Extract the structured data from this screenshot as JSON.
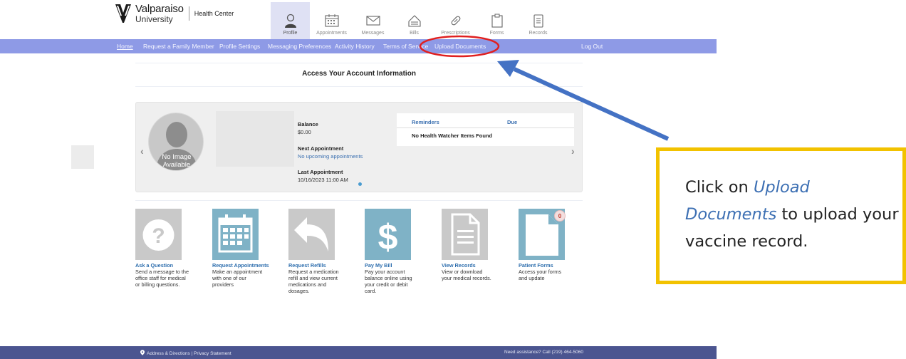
{
  "header": {
    "logo_name": "Valparaiso",
    "logo_sub": "University",
    "logo_product": "Health Center"
  },
  "top_nav": [
    {
      "label": "Profile",
      "icon": "profile-icon",
      "active": true
    },
    {
      "label": "Appointments",
      "icon": "calendar-icon",
      "active": false
    },
    {
      "label": "Messages",
      "icon": "envelope-icon",
      "active": false
    },
    {
      "label": "Bills",
      "icon": "bills-icon",
      "active": false
    },
    {
      "label": "Prescriptions",
      "icon": "pill-icon",
      "active": false
    },
    {
      "label": "Forms",
      "icon": "clipboard-icon",
      "active": false
    },
    {
      "label": "Records",
      "icon": "records-icon",
      "active": false
    }
  ],
  "nav_bar": {
    "items": [
      "Home",
      "Request a Family Member",
      "Profile Settings",
      "Messaging Preferences",
      "Activity History",
      "Terms of Service",
      "Upload Documents"
    ],
    "logout": "Log Out"
  },
  "page_title": "Access Your Account Information",
  "summary": {
    "avatar_text_1": "No Image",
    "avatar_text_2": "Available",
    "balance_label": "Balance",
    "balance_value": "$0.00",
    "next_label": "Next Appointment",
    "next_value": "No upcoming appointments",
    "last_label": "Last Appointment",
    "last_value": "10/16/2023 11:00 AM",
    "reminders_header": "Reminders",
    "due_header": "Due",
    "reminders_empty": "No Health Watcher Items Found"
  },
  "tiles": [
    {
      "title": "Ask a Question",
      "desc": "Send a message to the office staff for medical or billing questions.",
      "icon": "question-icon",
      "color": "#c9c9c9"
    },
    {
      "title": "Request Appointments",
      "desc": "Make an appointment with one of our providers",
      "icon": "calendar-icon",
      "color": "#7fb2c6"
    },
    {
      "title": "Request Refills",
      "desc": "Request a medication refill and view current medications and dosages.",
      "icon": "reply-arrow-icon",
      "color": "#c9c9c9"
    },
    {
      "title": "Pay My Bill",
      "desc": "Pay your account balance online using your credit or debit card.",
      "icon": "dollar-icon",
      "color": "#7fb2c6"
    },
    {
      "title": "View Records",
      "desc": "View or download your medical records.",
      "icon": "document-icon",
      "color": "#c9c9c9"
    },
    {
      "title": "Patient Forms",
      "desc": "Access your forms and update",
      "icon": "forms-icon",
      "color": "#7fb2c6",
      "badge": "0"
    }
  ],
  "footer": {
    "left": "Address & Directions | Privacy Statement",
    "right": "Need assistance? Call (219) 464-5060"
  },
  "callout": {
    "line_1": "Click on",
    "link": "Upload Documents",
    "line_2": "to upload your vaccine record.",
    "border_color": "#f2c200",
    "arrow_color": "#4472c4",
    "circle_color": "#e02020"
  }
}
